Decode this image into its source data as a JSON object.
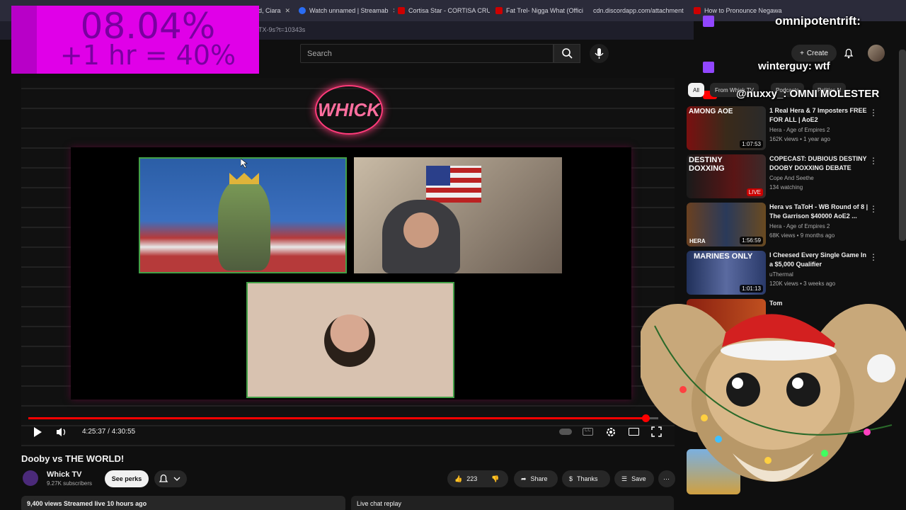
{
  "tabs": [
    {
      "label": "nd, Ciara",
      "color": "#cc0000"
    },
    {
      "label": "Watch unnamed | Streamab",
      "color": "#2a6df4"
    },
    {
      "label": "Cortisa Star - CORTISA CRUI",
      "color": "#cc0000"
    },
    {
      "label": "Fat Trel- Nigga What (Offici",
      "color": "#cc0000"
    },
    {
      "label": "cdn.discordapp.com/attachment",
      "color": "#5865f2"
    },
    {
      "label": "How to Pronounce Negawa",
      "color": "#cc0000"
    }
  ],
  "url": "TX-9s?t=10343s",
  "overlay": {
    "line1": "08.04%",
    "line2": "+1 hr = 40%"
  },
  "search": {
    "placeholder": "Search"
  },
  "header": {
    "create": "Create"
  },
  "chat": [
    {
      "text": "omnipotentrift:"
    },
    {
      "text": "winterguy: wtf"
    },
    {
      "text": "@nuxxy_: OMNI MOLESTER"
    }
  ],
  "video": {
    "neon": "WHICK",
    "time": "4:25:37 / 4:30:55",
    "progress": 0.98
  },
  "meta": {
    "title": "Dooby vs THE WORLD!",
    "channel": "Whick TV",
    "subs": "9.27K subscribers",
    "perks": "See perks",
    "likes": "223",
    "share": "Share",
    "thanks": "Thanks",
    "save": "Save",
    "views": "9,400 views  Streamed live 10 hours ago",
    "chat_replay": "Live chat replay"
  },
  "chips": [
    "All",
    "From Whick TV",
    "Podcasts",
    "Politics N"
  ],
  "recs": [
    {
      "title": "1 Real Hera & 7 Imposters FREE FOR ALL | AoE2",
      "channel": "Hera - Age of Empires 2",
      "stats": "162K views • 1 year ago",
      "dur": "1:07:53",
      "thumb": "AMONG AOE"
    },
    {
      "title": "COPECAST: DUBIOUS DESTINY DOOBY DOXXING DEBATE",
      "channel": "Cope And Seethe",
      "stats": "134 watching",
      "dur": "LIVE",
      "thumb": "DESTINY DOXXING"
    },
    {
      "title": "Hera vs TaToH - WB Round of 8 | The Garrison $40000 AoE2 ...",
      "channel": "Hera - Age of Empires 2",
      "stats": "68K views • 9 months ago",
      "dur": "1:56:59",
      "thumb": "HERA"
    },
    {
      "title": "I Cheesed Every Single Game In a $5,000 Qualifier",
      "channel": "uThermal",
      "stats": "120K views • 3 weeks ago",
      "dur": "1:01:13",
      "thumb": "MARINES ONLY"
    }
  ],
  "partial_rec": "Tom",
  "colors": {
    "accent": "#ff0000",
    "overlay": "#e000e8"
  }
}
